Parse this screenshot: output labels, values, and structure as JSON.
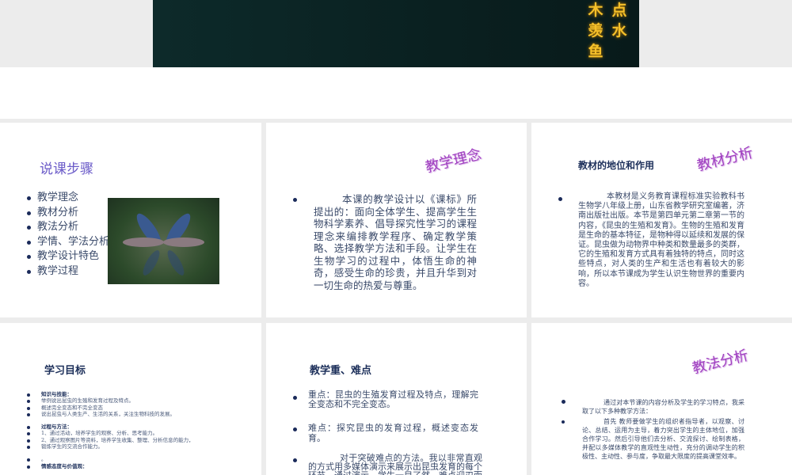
{
  "top_slide": {
    "col_left": [
      "木",
      "羡",
      "鱼"
    ],
    "col_right": [
      "点",
      "水"
    ]
  },
  "slide1": {
    "title": "说课步骤",
    "items": [
      "教学理念",
      "教材分析",
      "教法分析",
      "学情、学法分析",
      "教学设计特色",
      "教学过程"
    ]
  },
  "slide2": {
    "wordart": "教学理念",
    "text": "本课的教学设计以《课标》所提出的：面向全体学生、提高学生生物科学素养、倡导探究性学习的课程理念来编排教学程序、确定教学策略、选择教学方法和手段。让学生在生物学习的过程中，体悟生命的神奇，感受生命的珍贵，并且升华到对一切生命的热爱与尊重。"
  },
  "slide3": {
    "wordart": "教材分析",
    "heading": "教材的地位和作用",
    "text": "本教材是义务教育课程标准实验教科书生物学八年级上册，山东省教学研究室编著，济南出版社出版。本节是第四单元第二章第一节的内容，《昆虫的生殖和发育》。生物的生殖和发育是生命的基本特征，是物种得以延续和发展的保证。昆虫做为动物界中种类和数量最多的类群，它的生殖和发育方式具有着独特的特点，同时这些特点，对人类的生产和生活也有着较大的影响，所以本节课成为学生认识生物世界的重要内容。"
  },
  "slide4": {
    "title": "学习目标",
    "groups": [
      {
        "head": "知识与技能：",
        "items": [
          "举例说出昆虫的生殖和发育过程及特点。",
          "概述完全变态和不完全变态",
          "说出昆虫与人类生产、生活的关系，关注生物科技的发展。"
        ]
      },
      {
        "head": "过程与方法：",
        "items": [
          "1、通过活动，培养学生的观察、分析、思考能力。",
          "2、通过观察图片等资料，培养学生收集、整理、分析信息的能力，",
          "锻炼学生的交流合作能力。"
        ]
      },
      {
        "head": "情感态度与价值观：",
        "items": [
          "。"
        ]
      }
    ]
  },
  "slide5": {
    "title": "教学重、难点",
    "points": [
      "重点：昆虫的生殖发育过程及特点，理解完全变态和不完全变态。",
      "难点：探究昆虫的发育过程，概述变态发育。",
      "对于突破难点的方法。我以非常直观的方式用多媒体演示来展示出昆虫发育的每个环节。通过演示，学生一目了然，难点迎刃而解。"
    ]
  },
  "slide6": {
    "wordart": "教法分析",
    "points": [
      "通过对本节课的内容分析及学生的学习特点，我采取了以下多种教学方法：",
      "首先 教师要做学生的组织者指导者，以观察、讨论、总结、运用为主导，着力突出学生的主体地位，加强合作学习。然后引导他们去分析、交流探讨、绘制表格，并配以多媒体教学的直观性生动性，充分的调动学生的积极性、主动性、参与度，争取最大限度的提高课堂效率。"
    ]
  }
}
